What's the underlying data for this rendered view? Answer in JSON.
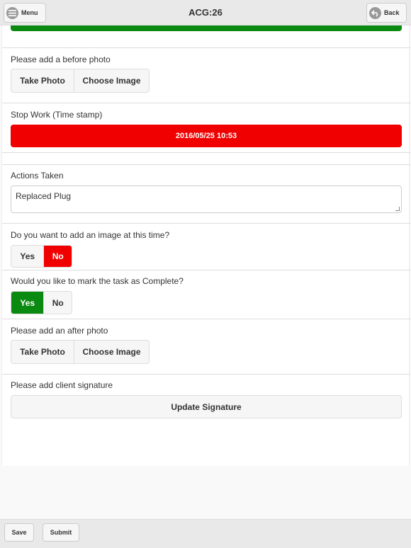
{
  "header": {
    "title": "ACG:26",
    "menu_label": "Menu",
    "back_label": "Back"
  },
  "colors": {
    "accent_green": "#0b8a12",
    "accent_red": "#f00000"
  },
  "before_photo": {
    "label": "Please add a before photo",
    "take_photo": "Take Photo",
    "choose_image": "Choose Image"
  },
  "stop_work": {
    "label": "Stop Work (Time stamp)",
    "timestamp": "2016/05/25 10:53"
  },
  "actions": {
    "label": "Actions Taken",
    "value": "Replaced Plug"
  },
  "add_image": {
    "label": "Do you want to add an image at this time?",
    "yes": "Yes",
    "no": "No",
    "selected": "No"
  },
  "complete": {
    "label": "Would you like to mark the task as Complete?",
    "yes": "Yes",
    "no": "No",
    "selected": "Yes"
  },
  "after_photo": {
    "label": "Please add an after photo",
    "take_photo": "Take Photo",
    "choose_image": "Choose Image"
  },
  "signature": {
    "label": "Please add client signature",
    "button": "Update Signature"
  },
  "footer": {
    "save": "Save",
    "submit": "Submit"
  }
}
